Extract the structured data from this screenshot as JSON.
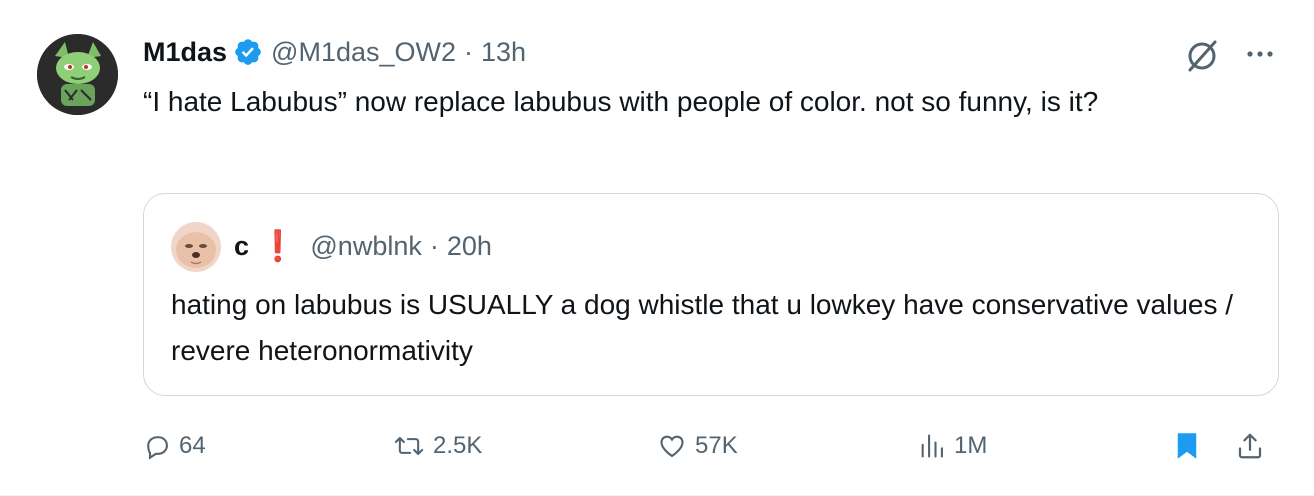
{
  "tweet": {
    "display_name": "M1das",
    "handle": "@M1das_OW2",
    "separator": "·",
    "time": "13h",
    "text": "“I hate Labubus” now replace labubus with people of color. not so funny, is it?"
  },
  "quote": {
    "display_name": "c",
    "name_mark": "❗",
    "handle": "@nwblnk",
    "separator": "·",
    "time": "20h",
    "text": "hating on labubus is USUALLY a dog whistle that u lowkey have conservative values / revere heteronormativity"
  },
  "actions": {
    "replies": "64",
    "reposts": "2.5K",
    "likes": "57K",
    "views": "1M"
  },
  "icons": {
    "verified": "verified-badge-icon",
    "grok": "grok-icon",
    "more": "more-icon",
    "reply": "reply-icon",
    "retweet": "retweet-icon",
    "like": "heart-icon",
    "views": "views-icon",
    "bookmark": "bookmark-icon",
    "share": "share-icon"
  },
  "colors": {
    "verified_blue": "#1d9bf0",
    "bookmark_blue": "#1d9bf0",
    "secondary_text": "#536471",
    "mark_red": "#d42a2a"
  }
}
